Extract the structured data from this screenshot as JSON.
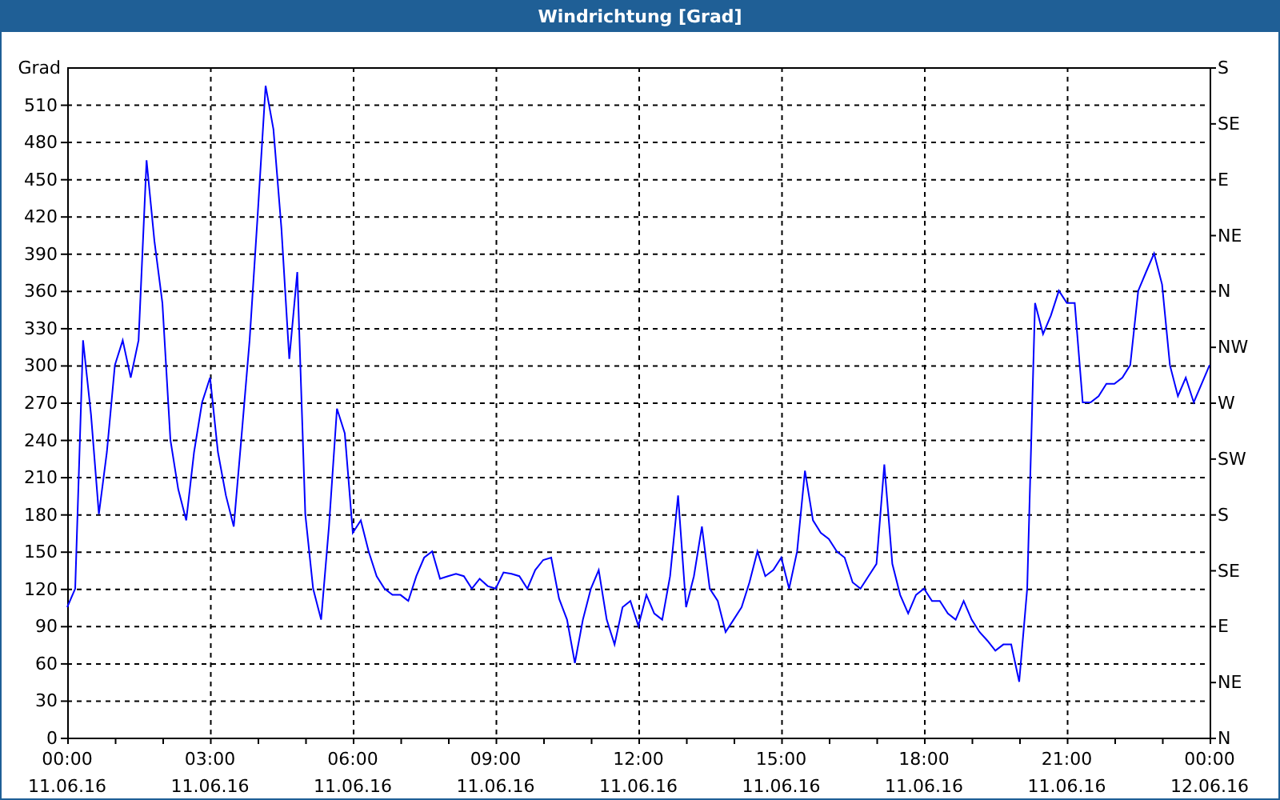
{
  "chart": {
    "chart_data": {
      "type": "line",
      "title": "Windrichtung [Grad]",
      "ylabel": "Grad",
      "ylim": [
        0,
        540
      ],
      "categories": [
        "00:00 11.06.16",
        null,
        null,
        null,
        null,
        null,
        null,
        null,
        null,
        null,
        null,
        null,
        null,
        null,
        null,
        null,
        null,
        null,
        "03:00 11.06.16",
        null,
        null,
        null,
        null,
        null,
        null,
        null,
        null,
        null,
        null,
        null,
        null,
        null,
        null,
        null,
        null,
        null,
        "06:00 11.06.16",
        null,
        null,
        null,
        null,
        null,
        null,
        null,
        null,
        null,
        null,
        null,
        null,
        null,
        null,
        null,
        null,
        null,
        "09:00 11.06.16",
        null,
        null,
        null,
        null,
        null,
        null,
        null,
        null,
        null,
        null,
        null,
        null,
        null,
        null,
        null,
        null,
        null,
        "12:00 11.06.16",
        null,
        null,
        null,
        null,
        null,
        null,
        null,
        null,
        null,
        null,
        null,
        null,
        null,
        null,
        null,
        null,
        null,
        "15:00 11.06.16",
        null,
        null,
        null,
        null,
        null,
        null,
        null,
        null,
        null,
        null,
        null,
        null,
        null,
        null,
        null,
        null,
        null,
        "18:00 11.06.16",
        null,
        null,
        null,
        null,
        null,
        null,
        null,
        null,
        null,
        null,
        null,
        null,
        null,
        null,
        null,
        null,
        null,
        "21:00 11.06.16",
        null,
        null,
        null,
        null,
        null,
        null,
        null,
        null,
        null,
        null,
        null,
        null,
        null,
        null,
        null,
        null,
        null,
        "00:00 12.06.16"
      ],
      "yticks": [
        0,
        30,
        60,
        90,
        120,
        150,
        180,
        210,
        240,
        270,
        300,
        330,
        360,
        390,
        420,
        450,
        480,
        510
      ],
      "grid": true,
      "y2ticks": [
        "N",
        "NE",
        "E",
        "SE",
        "S",
        "SW",
        "W",
        "NW",
        "N",
        "NE",
        "E",
        "SE",
        "S"
      ],
      "series": [
        {
          "color": "#0000ff",
          "values": [
            105,
            120,
            320,
            260,
            180,
            230,
            300,
            320,
            290,
            320,
            465,
            400,
            350,
            240,
            200,
            175,
            230,
            270,
            290,
            230,
            195,
            170,
            245,
            320,
            420,
            525,
            490,
            410,
            305,
            375,
            180,
            120,
            95,
            170,
            265,
            245,
            165,
            175,
            150,
            130,
            120,
            115,
            115,
            110,
            130,
            145,
            150,
            128,
            130,
            132,
            130,
            120,
            128,
            122,
            120,
            133,
            132,
            130,
            120,
            135,
            143,
            145,
            112,
            95,
            60,
            95,
            120,
            135,
            95,
            75,
            105,
            110,
            90,
            115,
            100,
            95,
            130,
            195,
            105,
            130,
            170,
            120,
            110,
            85,
            95,
            105,
            125,
            150,
            130,
            135,
            145,
            120,
            150,
            215,
            175,
            165,
            160,
            150,
            145,
            125,
            120,
            130,
            140,
            220,
            140,
            115,
            100,
            115,
            120,
            110,
            110,
            100,
            95,
            110,
            95,
            85,
            78,
            70,
            75,
            75,
            45,
            120,
            350,
            325,
            340,
            360,
            350,
            350,
            270,
            270,
            275,
            285,
            285,
            290,
            300,
            360,
            375,
            390,
            365,
            300,
            275,
            290,
            270,
            285,
            300
          ]
        }
      ]
    }
  }
}
